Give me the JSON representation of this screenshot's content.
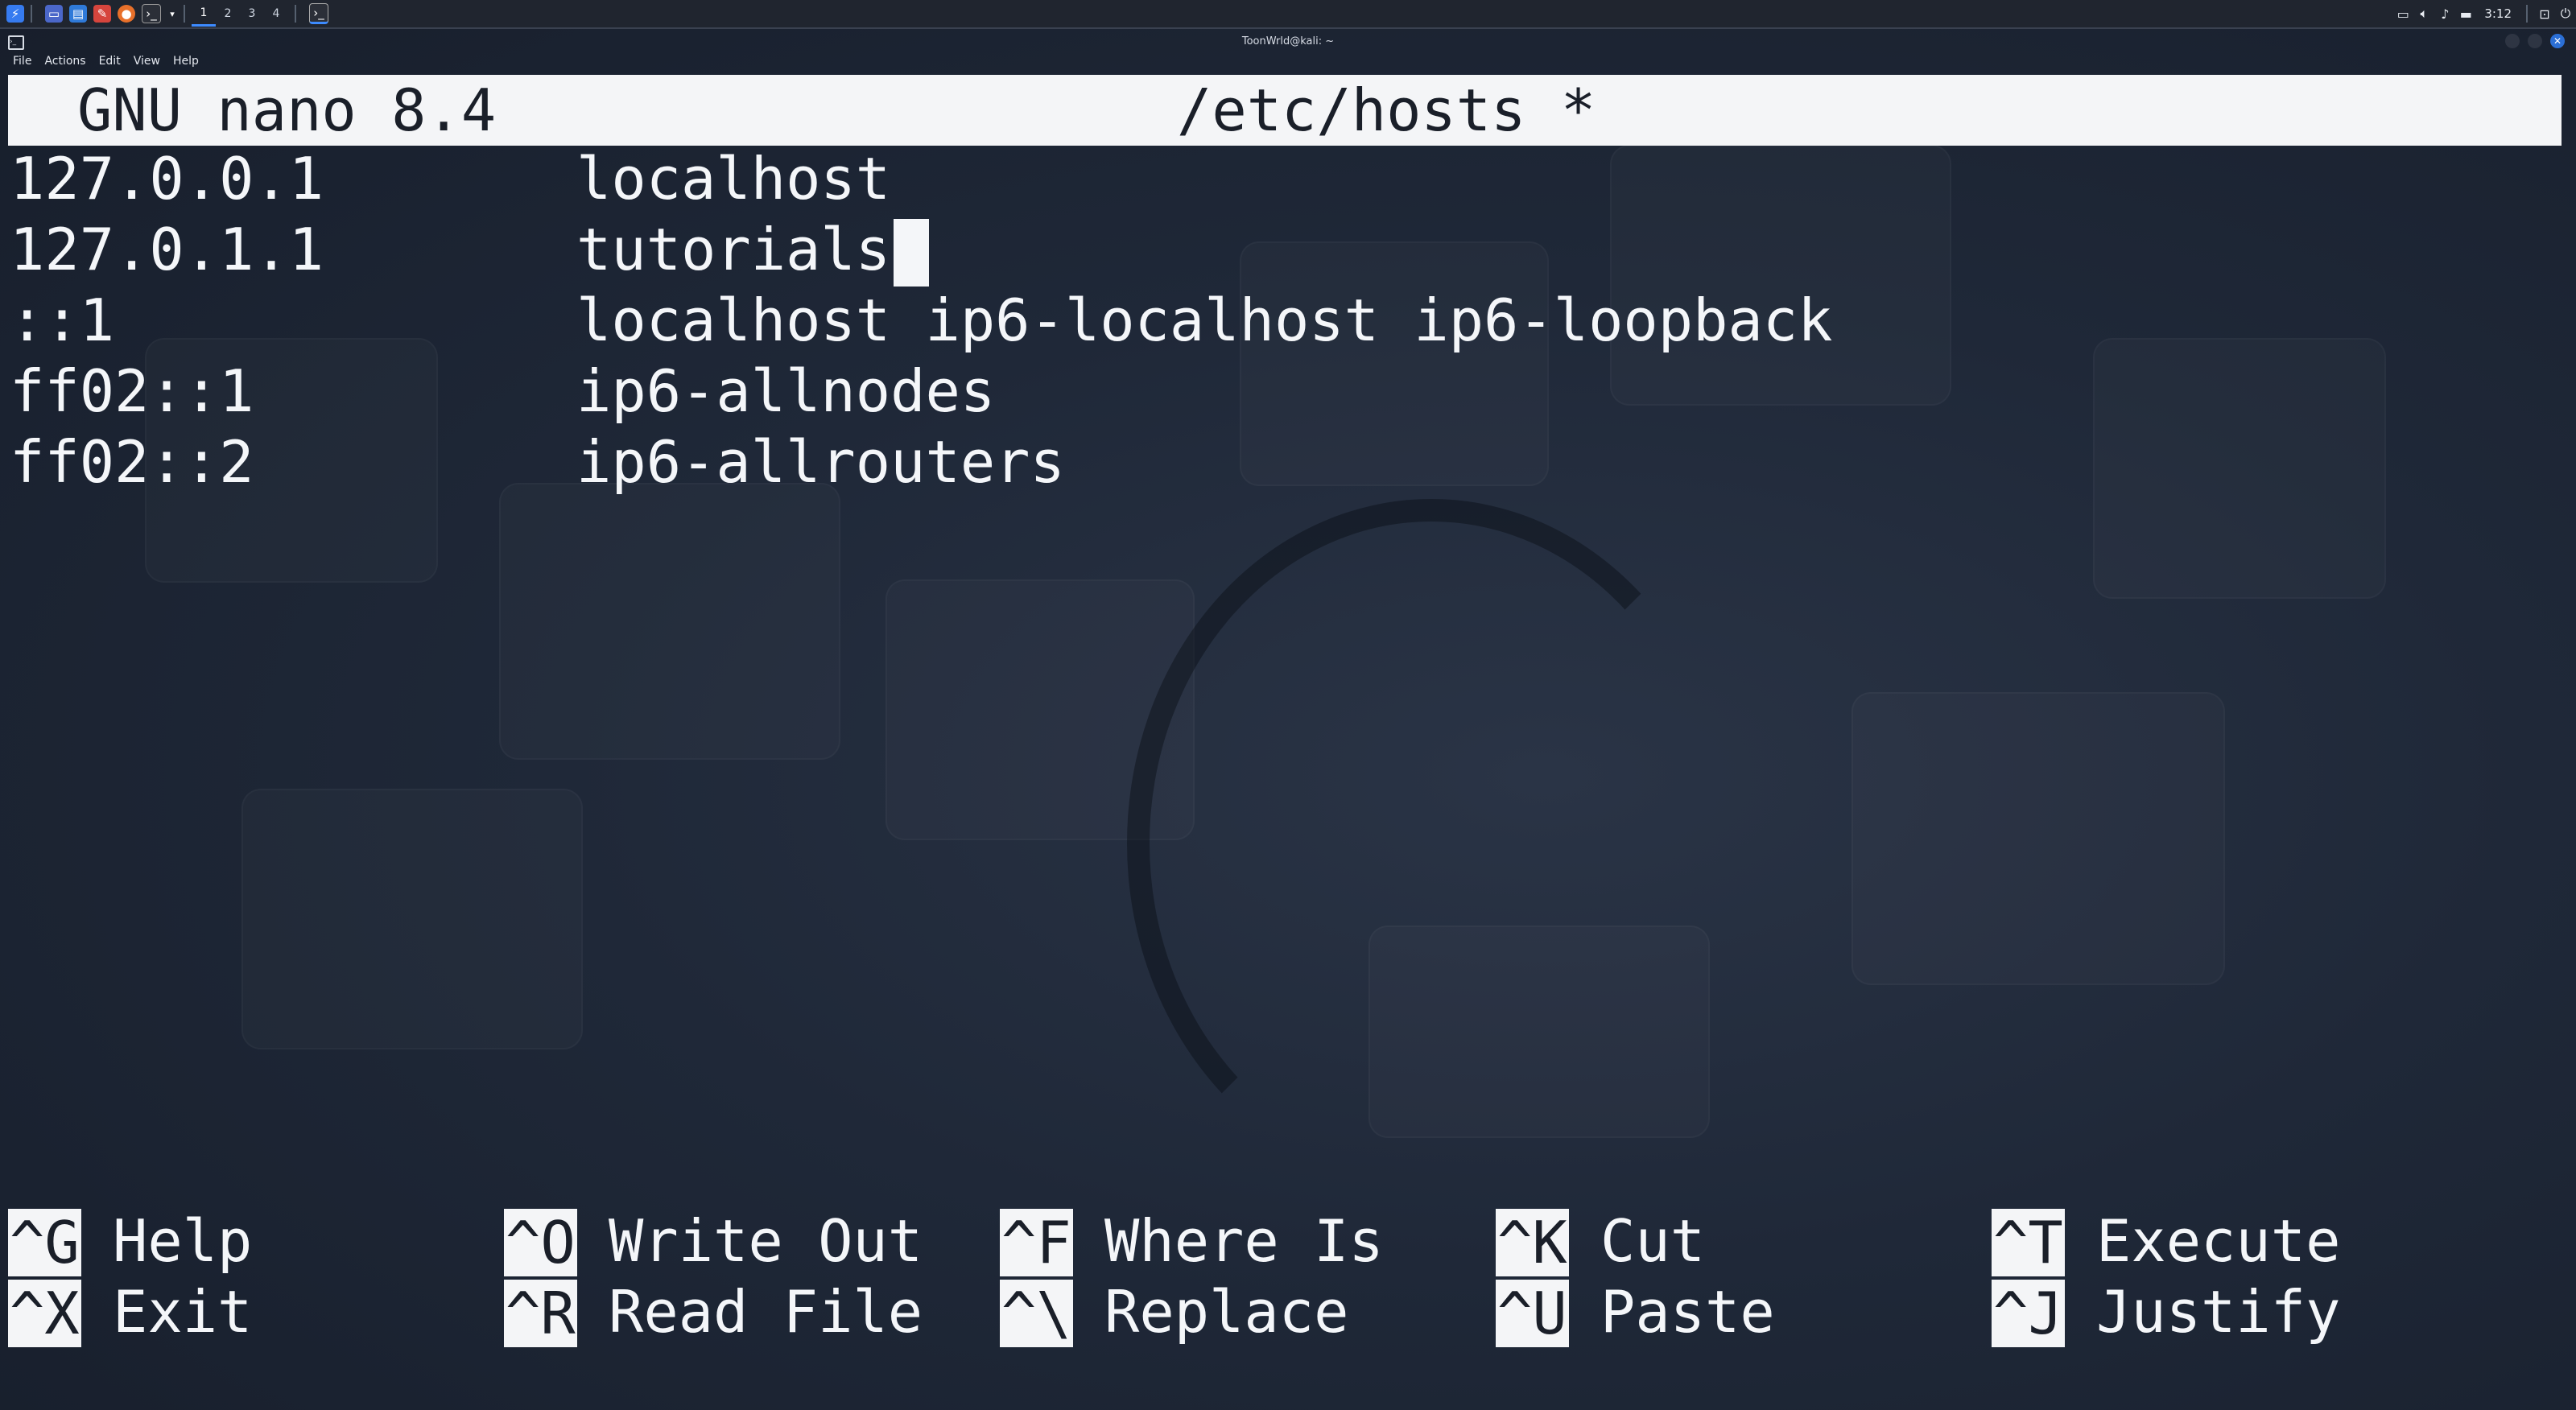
{
  "panel": {
    "workspaces": [
      "1",
      "2",
      "3",
      "4"
    ],
    "active_workspace": "1",
    "clock": "3:12"
  },
  "window": {
    "title": "ToonWrld@kali: ~",
    "menu": [
      "File",
      "Actions",
      "Edit",
      "View",
      "Help"
    ]
  },
  "nano": {
    "app_version": "GNU nano 8.4",
    "file_title": "/etc/hosts *",
    "lines": [
      {
        "ip": "127.0.0.1",
        "host": "localhost"
      },
      {
        "ip": "127.0.1.1",
        "host": "tutorials"
      },
      {
        "ip": "::1",
        "host": "localhost ip6-localhost ip6-loopback"
      },
      {
        "ip": "ff02::1",
        "host": "ip6-allnodes"
      },
      {
        "ip": "ff02::2",
        "host": "ip6-allrouters"
      }
    ],
    "shortcuts": [
      {
        "key": "^G",
        "label": "Help"
      },
      {
        "key": "^X",
        "label": "Exit"
      },
      {
        "key": "^O",
        "label": "Write Out"
      },
      {
        "key": "^R",
        "label": "Read File"
      },
      {
        "key": "^F",
        "label": "Where Is"
      },
      {
        "key": "^\\",
        "label": "Replace"
      },
      {
        "key": "^K",
        "label": "Cut"
      },
      {
        "key": "^U",
        "label": "Paste"
      },
      {
        "key": "^T",
        "label": "Execute"
      },
      {
        "key": "^J",
        "label": "Justify"
      }
    ]
  },
  "colors": {
    "panel_bg": "#20252f",
    "accent": "#3d8bff",
    "terminal_fg": "#f4f6f9",
    "header_bg": "#f4f5f7",
    "header_fg": "#1a1f29"
  },
  "icons": {
    "launcher": "kali-dragon-icon",
    "tray": [
      "display-icon",
      "volume-icon",
      "notification-bell-icon",
      "battery-icon",
      "lock-icon",
      "power-icon"
    ]
  }
}
